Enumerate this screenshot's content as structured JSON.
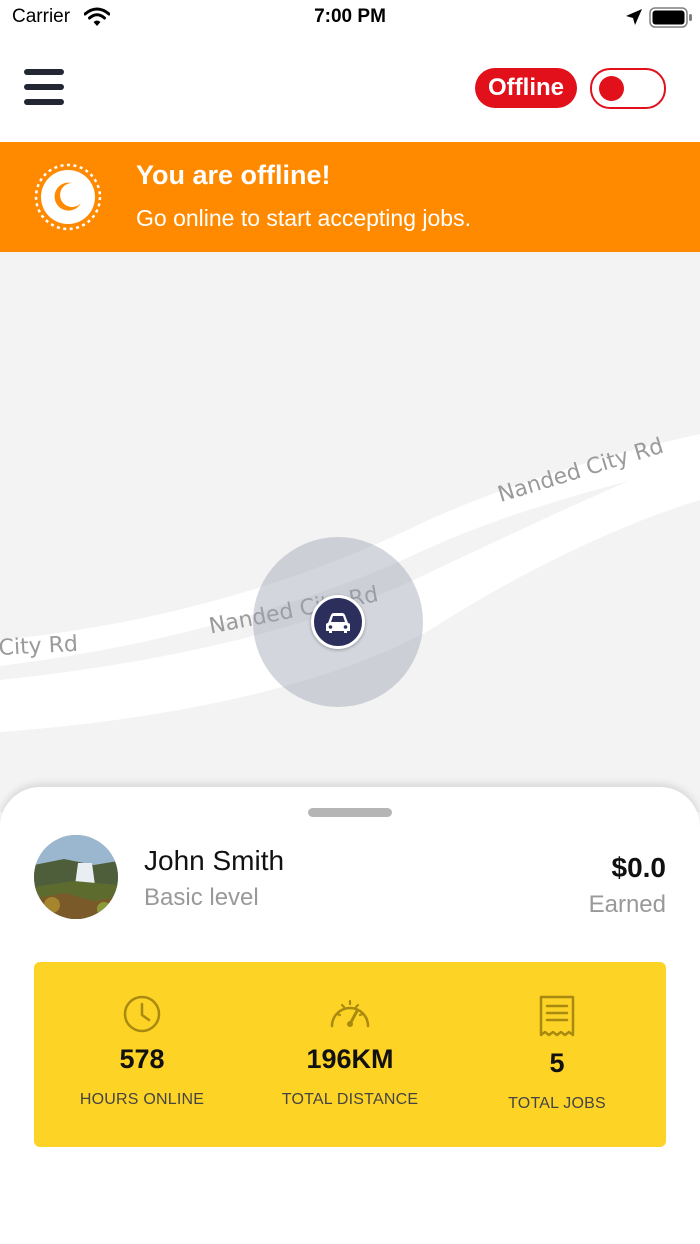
{
  "status_bar": {
    "carrier": "Carrier",
    "time": "7:00 PM",
    "icons": [
      "wifi-icon",
      "location-arrow-icon",
      "battery-icon"
    ]
  },
  "header": {
    "menu_icon": "hamburger-menu-icon",
    "status_badge": "Offline",
    "toggle_on": false,
    "accent_color": "#e1101a"
  },
  "banner": {
    "icon": "moon-icon",
    "title": "You are offline!",
    "subtitle": "Go online to start accepting jobs.",
    "color": "#ff8a00"
  },
  "map": {
    "road_labels": [
      "Nanded City Rd",
      "Nanded City Rd",
      "City Rd"
    ],
    "marker_icon": "car-icon"
  },
  "profile": {
    "name": "John Smith",
    "level": "Basic level",
    "earned_amount": "$0.0",
    "earned_label": "Earned"
  },
  "stats": {
    "color": "#fdd325",
    "items": [
      {
        "icon": "clock-icon",
        "value": "578",
        "label": "HOURS ONLINE"
      },
      {
        "icon": "speedometer-icon",
        "value": "196KM",
        "label": "TOTAL DISTANCE"
      },
      {
        "icon": "receipt-icon",
        "value": "5",
        "label": "TOTAL JOBS"
      }
    ]
  }
}
